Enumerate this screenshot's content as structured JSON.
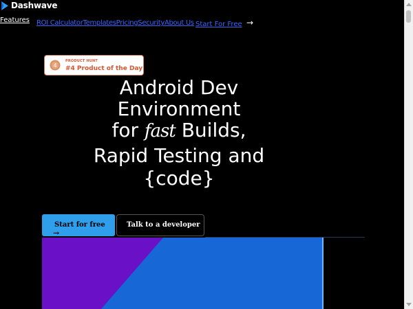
{
  "brand": {
    "name": "Dashwave"
  },
  "nav": {
    "features": "Features",
    "links": [
      "ROI Calculator",
      "Templates",
      "Pricing",
      "Security",
      "About Us"
    ],
    "cta": "Start For Free",
    "cta_arrow": "→"
  },
  "badge": {
    "small": "PRODUCT HUNT",
    "big": "#4 Product of the Day",
    "medal_number": "4"
  },
  "hero": {
    "line1": "Android Dev",
    "line2": "Environment",
    "line3_before": "for ",
    "line3_emph": "fast",
    "line3_after": " Builds,",
    "line4": "Rapid Testing and",
    "line5": "{code}"
  },
  "buttons": {
    "primary": "Start for free",
    "primary_arrow": "→",
    "secondary": "Talk to a developer"
  },
  "colors": {
    "background": "#000000",
    "link": "#3b64ff",
    "primary_button": "#2f9fec",
    "badge_accent": "#da552f",
    "preview_purple": "#6a10c6",
    "preview_blue": "#1767d6"
  }
}
